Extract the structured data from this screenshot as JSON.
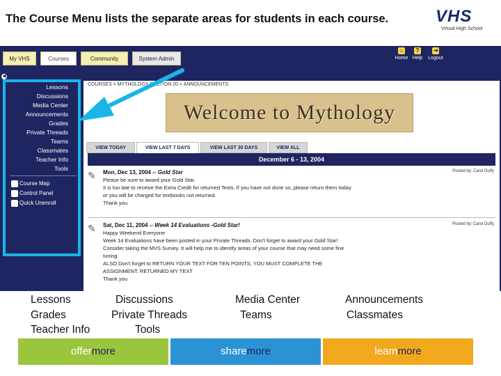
{
  "slide": {
    "title": "The Course Menu lists the separate areas for students in each course."
  },
  "logo": {
    "text": "VHS",
    "subtext": "Virtual High School"
  },
  "topnav": {
    "tabs": [
      {
        "label": "My VHS"
      },
      {
        "label": "Courses"
      },
      {
        "label": "Community"
      },
      {
        "label": "System Admin"
      }
    ],
    "utilities": [
      {
        "label": "Home",
        "icon": "home-icon",
        "glyph": "⌂"
      },
      {
        "label": "Help",
        "icon": "help-icon",
        "glyph": "?"
      },
      {
        "label": "Logout",
        "icon": "logout-icon",
        "glyph": "⇥"
      }
    ]
  },
  "course_menu": {
    "items": [
      "Lessons",
      "Discussions",
      "Media Center",
      "Announcements",
      "Grades",
      "Private Threads",
      "Teams",
      "Classmates",
      "Teacher Info",
      "Tools"
    ],
    "tools": [
      {
        "label": "Course Map",
        "icon": "course-map-icon"
      },
      {
        "label": "Control Panel",
        "icon": "control-panel-icon"
      },
      {
        "label": "Quick Unenroll",
        "icon": "quick-unenroll-icon"
      }
    ]
  },
  "content": {
    "breadcrumb": "COURSES > MYTHOLOGY SECTION 20 > ANNOUNCEMENTS",
    "banner": "Welcome to Mythology",
    "view_tabs": [
      "VIEW TODAY",
      "VIEW LAST 7 DAYS",
      "VIEW LAST 30 DAYS",
      "VIEW ALL"
    ],
    "date_range": "December 6 - 13, 2004",
    "posts": [
      {
        "date": "Mon, Dec 13, 2004",
        "separator": " -- ",
        "subject": "Gold Star",
        "posted_by": "Posted by: Carol Duffy",
        "lines": [
          "Please be sure to award your Gold Star.",
          "It is too late to receive the Extra Credit for returned Texts. If you have not done so, please return them today",
          "or you will be charged for textbooks not returned.",
          "Thank you."
        ]
      },
      {
        "date": "Sat, Dec 11, 2004",
        "separator": " -- ",
        "subject": "Week 14 Evaluations -Gold Star!",
        "posted_by": "Posted by: Carol Duffy",
        "lines": [
          "Happy Weekend Everyone",
          "Week 14 Evaluations have been posted in your Private Threads. Don't forget to award your Gold Star!",
          "Consider taking the MVS Survey. It will help me to identify areas of your course that may need some fine",
          "tuning",
          "ALSO Don't forget to RETURN YOUR TEXT FOR TEN POINTS, YOU MUST COMPLETE THE",
          "ASSIGNMENT: RETURNED MY TEXT",
          "Thank you"
        ]
      }
    ]
  },
  "caption": {
    "row1": [
      "Lessons",
      "Discussions",
      "Media Center",
      "Announcements"
    ],
    "row2": [
      "Grades",
      "Private Threads",
      "Teams",
      "Classmates"
    ],
    "row3": [
      "Teacher Info",
      "Tools"
    ]
  },
  "footer": {
    "panels": [
      {
        "word1": "offer",
        "word2": "more",
        "color": "#9bc53d"
      },
      {
        "word1": "share",
        "word2": "more",
        "color": "#2b93d4"
      },
      {
        "word1": "learn",
        "word2": "more",
        "color": "#f2a81d"
      }
    ]
  }
}
